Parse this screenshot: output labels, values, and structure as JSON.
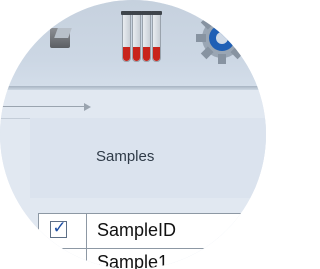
{
  "toolbar": {
    "icons": [
      {
        "name": "partial-grey-icon"
      },
      {
        "name": "test-tubes-icon"
      },
      {
        "name": "gear-icon"
      }
    ]
  },
  "panel": {
    "title": "Samples"
  },
  "table": {
    "header": {
      "checked": true,
      "checkbox_glyph": "✓",
      "column": "SampleID"
    },
    "rows": [
      {
        "value": "Sample1"
      }
    ]
  },
  "colors": {
    "tube_liquid": "#c8241c",
    "checkmark": "#1d4ea3"
  }
}
